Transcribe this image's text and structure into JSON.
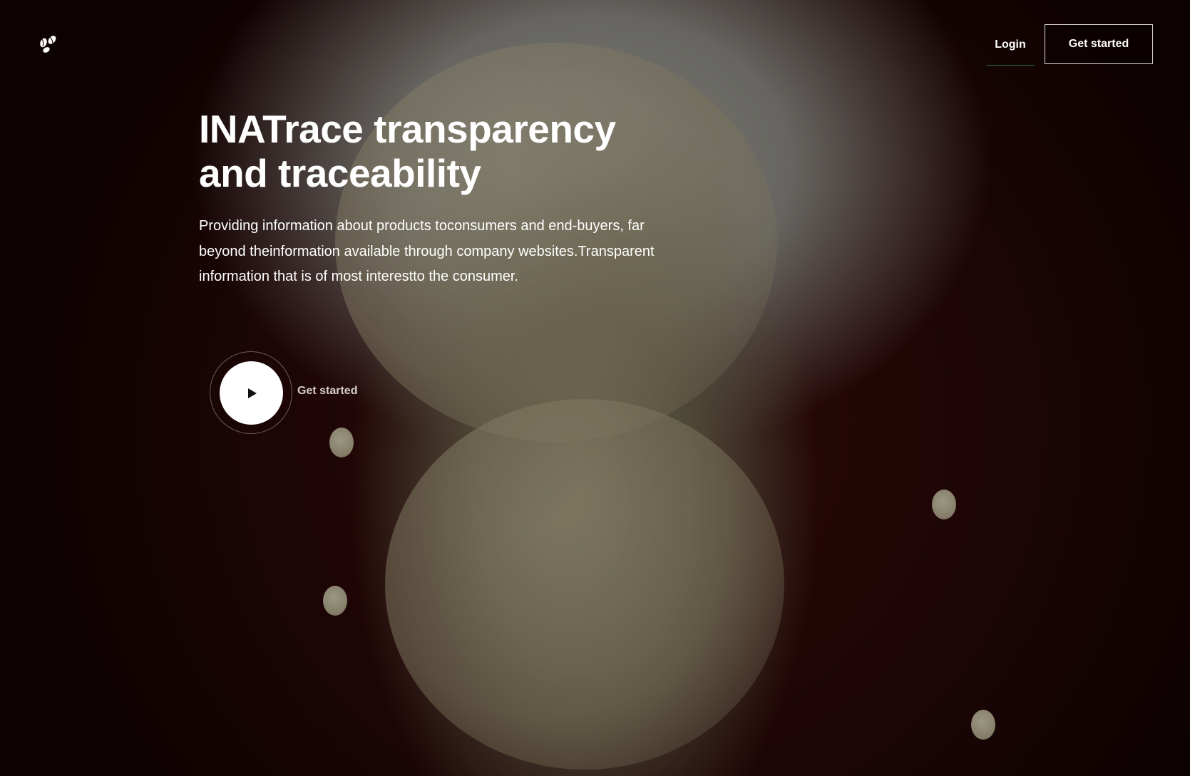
{
  "header": {
    "logo_icon": "coffee-beans-icon",
    "login_label": "Login",
    "get_started_label": "Get started"
  },
  "hero": {
    "title_line1": "INATrace transparency",
    "title_line2": "and traceability",
    "description": "Providing information about products toconsumers and end-buyers, far beyond theinformation available through company websites.Transparent information that is of most interestto the consumer.",
    "play_icon": "play-icon",
    "play_label": "Get started"
  },
  "colors": {
    "background_dark": "#2a0808",
    "text": "#ffffff",
    "login_underline": "#3ca06e"
  }
}
